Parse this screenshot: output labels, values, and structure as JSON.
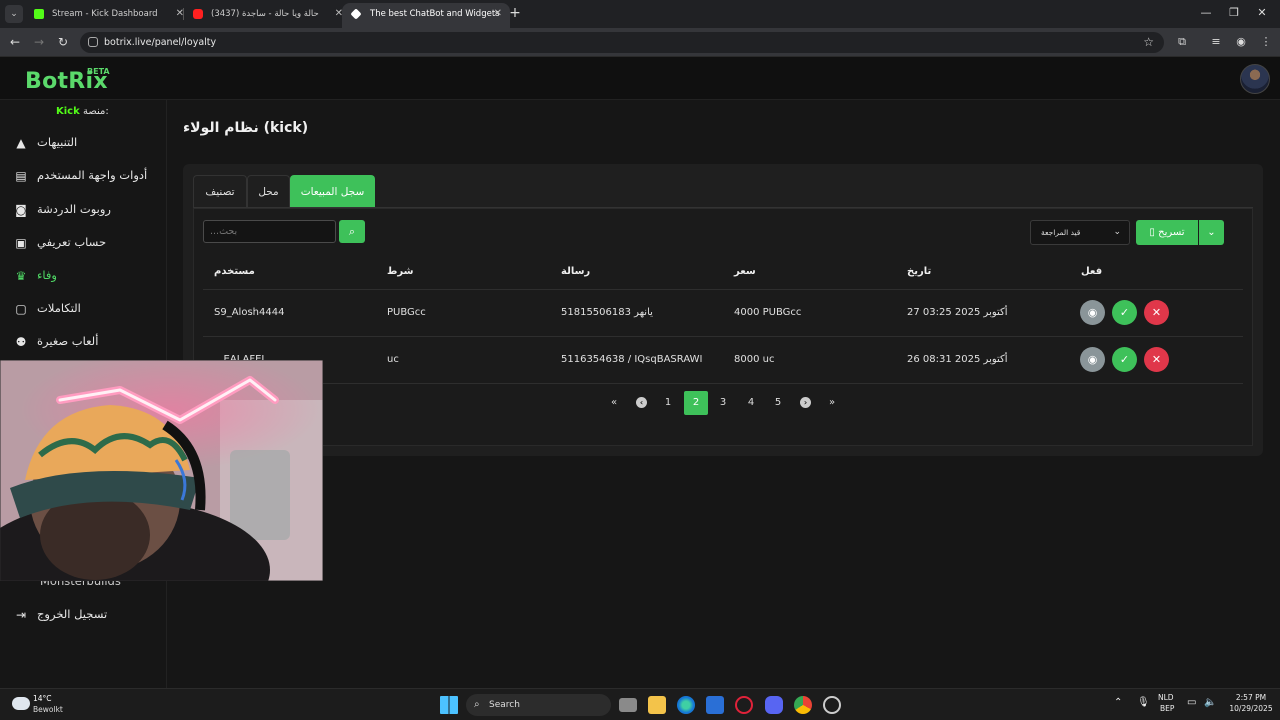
{
  "browser": {
    "tabs": [
      {
        "title": "Stream - Kick Dashboard",
        "active": false
      },
      {
        "title": "(3437) حالة ويا حالة - ساجدة",
        "active": false
      },
      {
        "title": "The best ChatBot and Widgets",
        "active": true
      }
    ],
    "url": "botrix.live/panel/loyalty"
  },
  "app": {
    "logo": "BotRix",
    "logo_badge": "BETA"
  },
  "sidebar": {
    "platform_label": "منصة:",
    "platform_value": "Kick",
    "items": [
      {
        "label": "التنبيهات",
        "icon": "warning-icon"
      },
      {
        "label": "أدوات واجهة المستخدم",
        "icon": "widgets-icon"
      },
      {
        "label": "روبوت الدردشة",
        "icon": "robot-icon"
      },
      {
        "label": "حساب تعريفي",
        "icon": "id-card-icon"
      },
      {
        "label": "وفاء",
        "icon": "trophy-icon",
        "active": true
      },
      {
        "label": "التكاملات",
        "icon": "integrations-icon"
      },
      {
        "label": "ألعاب صغيرة",
        "icon": "gamepad-icon"
      },
      {
        "label": "Monsterbuilds",
        "icon": "monster-icon"
      },
      {
        "label": "تسجيل الخروج",
        "icon": "logout-icon"
      }
    ]
  },
  "main": {
    "title": "نظام الولاء (kick)",
    "tabs": [
      {
        "label": "تصنيف"
      },
      {
        "label": "محل"
      },
      {
        "label": "سجل المبيعات",
        "active": true
      }
    ],
    "export_label": "تسريح",
    "filter_label": "قيد المراجعة",
    "search_placeholder": "...بحث",
    "columns": {
      "user": "مستخدم",
      "condition": "شرط",
      "message": "رسالة",
      "price": "سعر",
      "date": "تاريخ",
      "action": "فعل"
    },
    "rows": [
      {
        "user": "S9_Alosh4444",
        "condition": "PUBGcc",
        "message": "51815506183 يانهر",
        "price": "4000 PUBGcc",
        "date": "27 أكتوبر 2025 03:25"
      },
      {
        "user": "...EALAFEL",
        "condition": "uc",
        "message": "5116354638 / IQsqBASRAWI",
        "price": "8000 uc",
        "date": "26 أكتوبر 2025 08:31"
      }
    ],
    "pagination": {
      "pages": [
        "1",
        "2",
        "3",
        "4",
        "5"
      ],
      "current": "2"
    }
  },
  "taskbar": {
    "weather_temp": "14°C",
    "weather_desc": "Bewolkt",
    "search_label": "Search",
    "lang_top": "NLD",
    "lang_bottom": "BEP",
    "time": "2:57 PM",
    "date": "10/29/2025"
  },
  "colors": {
    "accent": "#3ec15a",
    "danger": "#e0374a",
    "kick": "#53fc18"
  }
}
